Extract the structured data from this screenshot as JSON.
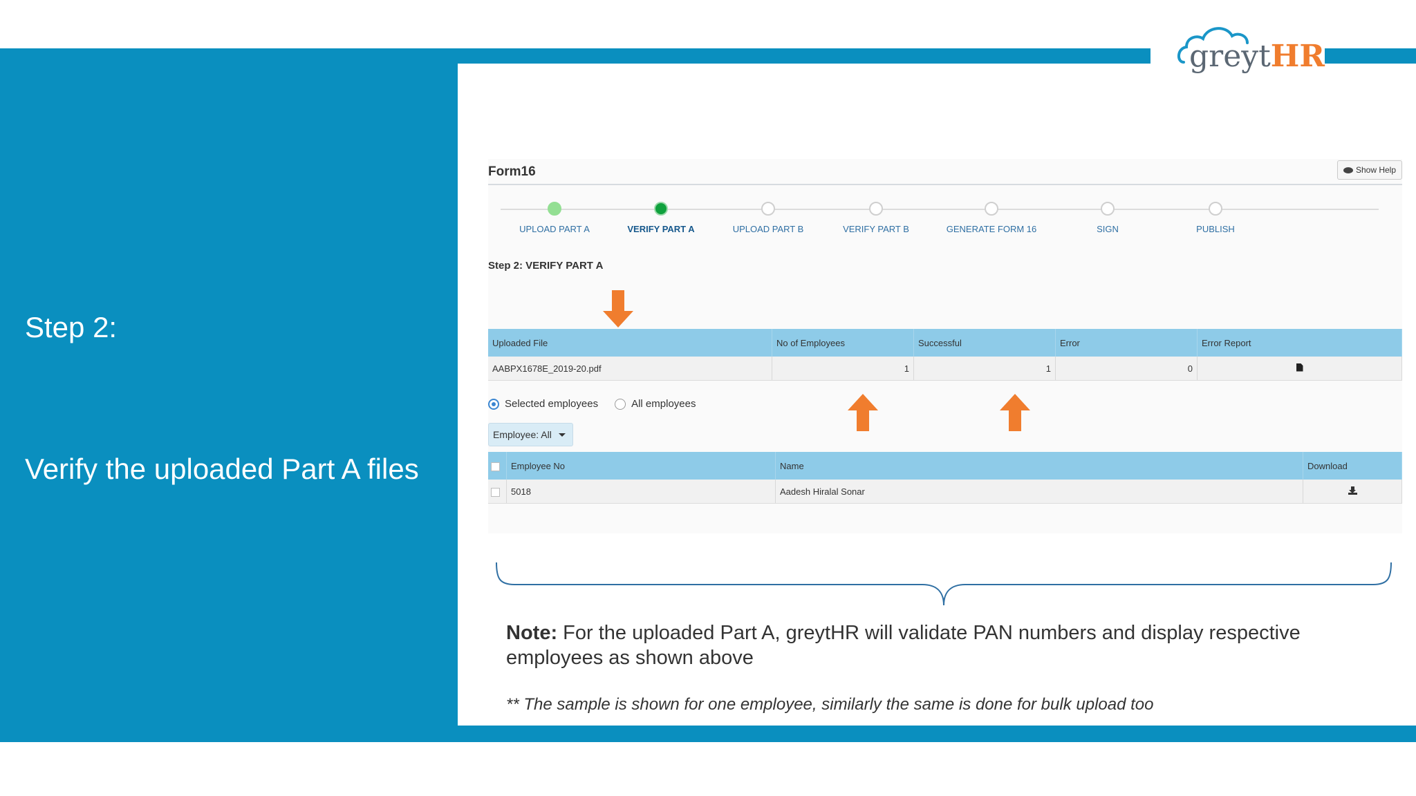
{
  "slide": {
    "step_label": "Step 2:",
    "description": "Verify the uploaded Part A files",
    "logo": {
      "prefix": "greyt",
      "suffix": "HR"
    },
    "note_label": "Note:",
    "note_text": " For the uploaded Part A, greytHR will validate PAN numbers and display respective employees as shown above",
    "footnote": "** The sample is shown for one employee, similarly the same is done for bulk upload too",
    "colors": {
      "band": "#0a8fbf",
      "accent": "#f07d2e",
      "header": "#8ecbe8"
    }
  },
  "app": {
    "title": "Form16",
    "show_help": "Show Help",
    "steps": [
      {
        "label": "UPLOAD PART A",
        "state": "done"
      },
      {
        "label": "VERIFY PART A",
        "state": "active"
      },
      {
        "label": "UPLOAD PART B",
        "state": "pending"
      },
      {
        "label": "VERIFY PART B",
        "state": "pending"
      },
      {
        "label": "GENERATE FORM 16",
        "state": "pending"
      },
      {
        "label": "SIGN",
        "state": "pending"
      },
      {
        "label": "PUBLISH",
        "state": "pending"
      }
    ],
    "step_heading": "Step 2: VERIFY PART A",
    "upload_table": {
      "headers": [
        "Uploaded File",
        "No of Employees",
        "Successful",
        "Error",
        "Error Report"
      ],
      "row": {
        "file": "AABPX1678E_2019-20.pdf",
        "employees": "1",
        "successful": "1",
        "error": "0"
      }
    },
    "radios": {
      "selected": "Selected employees",
      "all": "All employees"
    },
    "employee_filter": "Employee: All",
    "employee_table": {
      "headers": [
        "Employee No",
        "Name",
        "Download"
      ],
      "row": {
        "emp_no": "5018",
        "name": "Aadesh Hiralal Sonar"
      }
    }
  }
}
